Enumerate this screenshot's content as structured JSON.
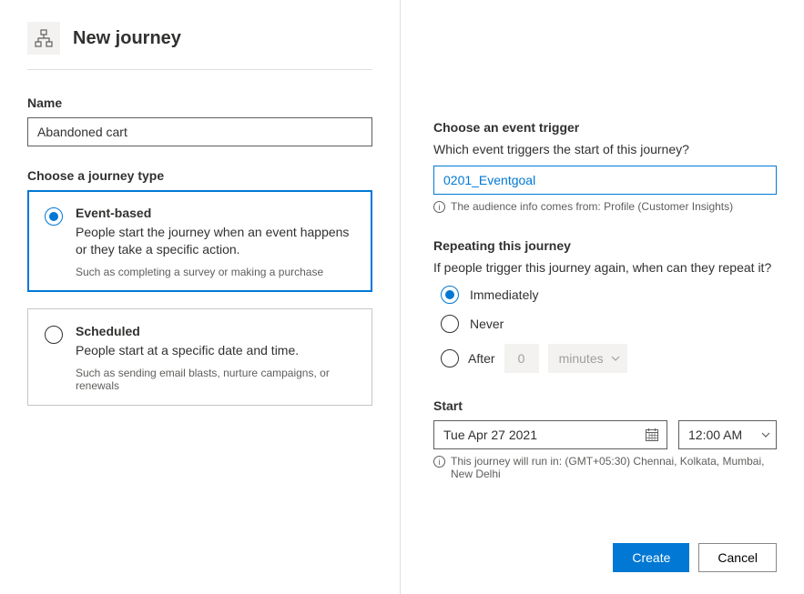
{
  "header": {
    "title": "New journey"
  },
  "left": {
    "name_label": "Name",
    "name_value": "Abandoned cart",
    "type_label": "Choose a journey type",
    "event_based": {
      "title": "Event-based",
      "desc": "People start the journey when an event happens or they take a specific action.",
      "hint": "Such as completing a survey or making a purchase"
    },
    "scheduled": {
      "title": "Scheduled",
      "desc": "People start at a specific date and time.",
      "hint": "Such as sending email blasts, nurture campaigns, or renewals"
    }
  },
  "right": {
    "trigger_label": "Choose an event trigger",
    "trigger_sub": "Which event triggers the start of this journey?",
    "trigger_value": "0201_Eventgoal",
    "audience_info": "The audience info comes from: Profile (Customer Insights)",
    "repeat_label": "Repeating this journey",
    "repeat_sub": "If people trigger this journey again, when can they repeat it?",
    "repeat_options": {
      "immediately": "Immediately",
      "never": "Never",
      "after": "After",
      "after_value": "0",
      "after_unit": "minutes"
    },
    "start_label": "Start",
    "start_date": "Tue Apr 27 2021",
    "start_time": "12:00 AM",
    "tz_info": "This journey will run in: (GMT+05:30) Chennai, Kolkata, Mumbai, New Delhi"
  },
  "footer": {
    "create": "Create",
    "cancel": "Cancel"
  }
}
